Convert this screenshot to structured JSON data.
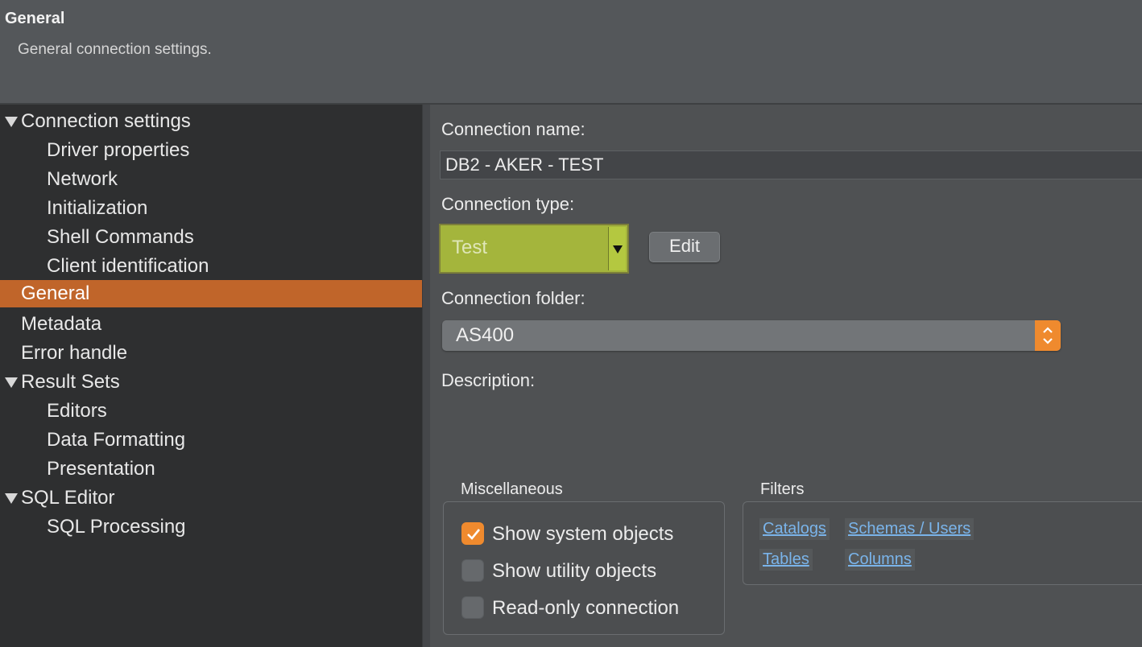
{
  "header": {
    "title": "General",
    "subtitle": "General connection settings."
  },
  "tree": {
    "items": [
      {
        "label": "Connection settings",
        "level": 0,
        "expandable": true
      },
      {
        "label": "Driver properties",
        "level": 1
      },
      {
        "label": "Network",
        "level": 1
      },
      {
        "label": "Initialization",
        "level": 1
      },
      {
        "label": "Shell Commands",
        "level": 1
      },
      {
        "label": "Client identification",
        "level": 1
      },
      {
        "label": "General",
        "level": 0,
        "selected": true
      },
      {
        "label": "Metadata",
        "level": 0
      },
      {
        "label": "Error handle",
        "level": 0
      },
      {
        "label": "Result Sets",
        "level": 0,
        "expandable": true
      },
      {
        "label": "Editors",
        "level": 1
      },
      {
        "label": "Data Formatting",
        "level": 1
      },
      {
        "label": "Presentation",
        "level": 1
      },
      {
        "label": "SQL Editor",
        "level": 0,
        "expandable": true
      },
      {
        "label": "SQL Processing",
        "level": 1
      }
    ]
  },
  "form": {
    "connection_name_label": "Connection name:",
    "connection_name_value": "DB2 - AKER - TEST",
    "connection_type_label": "Connection type:",
    "connection_type_value": "Test",
    "edit_label": "Edit",
    "connection_folder_label": "Connection folder:",
    "connection_folder_value": "AS400",
    "description_label": "Description:"
  },
  "misc": {
    "title": "Miscellaneous",
    "show_system_objects": {
      "label": "Show system objects",
      "checked": true
    },
    "show_utility_objects": {
      "label": "Show utility objects",
      "checked": false
    },
    "read_only_connection": {
      "label": "Read-only connection",
      "checked": false
    }
  },
  "filters": {
    "title": "Filters",
    "catalogs": "Catalogs",
    "schemas_users": "Schemas / Users",
    "tables": "Tables",
    "columns": "Columns"
  },
  "colors": {
    "selection": "#c0652a",
    "accent": "#ef8a2e",
    "connection_type_test": "#a4b53c",
    "link": "#7ab4ea"
  }
}
